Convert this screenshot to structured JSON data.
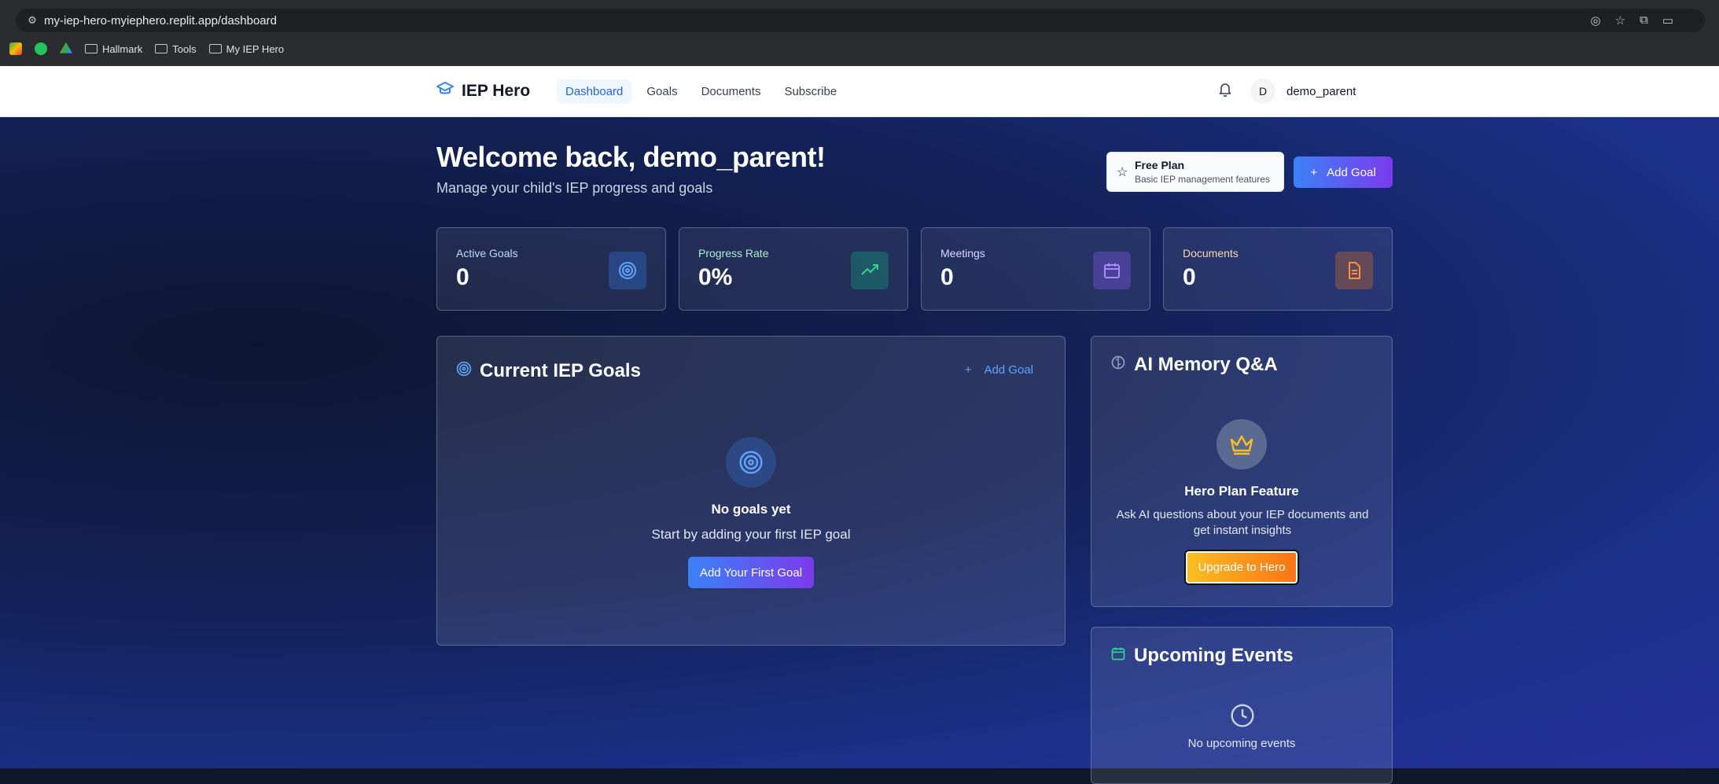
{
  "browser": {
    "url": "my-iep-hero-myiephero.replit.app/dashboard",
    "bookmarks": [
      "Hallmark",
      "Tools",
      "My IEP Hero"
    ]
  },
  "header": {
    "brand": "IEP Hero",
    "nav": [
      "Dashboard",
      "Goals",
      "Documents",
      "Subscribe"
    ],
    "avatar_initial": "D",
    "username": "demo_parent"
  },
  "welcome": {
    "title": "Welcome back, demo_parent!",
    "subtitle": "Manage your child's IEP progress and goals"
  },
  "plan": {
    "name": "Free Plan",
    "description": "Basic IEP management features"
  },
  "add_goal_label": "Add Goal",
  "stats": [
    {
      "label": "Active Goals",
      "value": "0",
      "color": "#60a5fa"
    },
    {
      "label": "Progress Rate",
      "value": "0%",
      "color": "#34d399"
    },
    {
      "label": "Meetings",
      "value": "0",
      "color": "#a78bfa"
    },
    {
      "label": "Documents",
      "value": "0",
      "color": "#fb923c"
    }
  ],
  "goals_card": {
    "title": "Current IEP Goals",
    "add_label": "Add Goal",
    "empty_title": "No goals yet",
    "empty_text": "Start by adding your first IEP goal",
    "button": "Add Your First Goal"
  },
  "ai_card": {
    "title": "AI Memory Q&A",
    "feature_title": "Hero Plan Feature",
    "feature_desc": "Ask AI questions about your IEP documents and get instant insights",
    "button": "Upgrade to Hero"
  },
  "events_card": {
    "title": "Upcoming Events",
    "empty_text": "No upcoming events"
  }
}
